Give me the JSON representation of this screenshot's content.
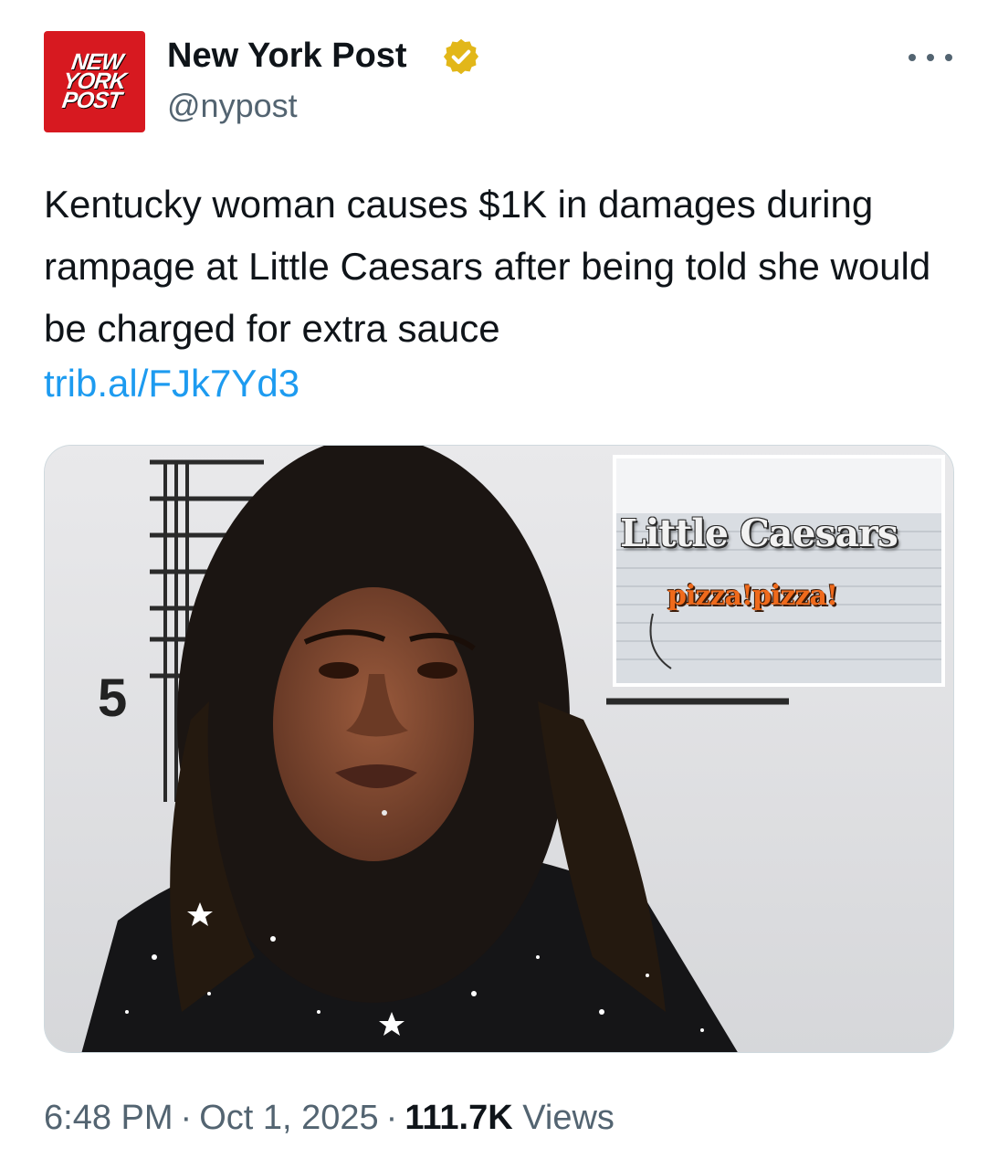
{
  "author": {
    "avatar_text": "NEW\nYORK\nPOST",
    "display_name": "New York Post",
    "handle": "@nypost",
    "verified": true
  },
  "tweet": {
    "text": "Kentucky woman causes $1K in damages during rampage at Little Caesars after being told she would be charged for extra sauce",
    "link": "trib.al/FJk7Yd3"
  },
  "media": {
    "ruler_number": "5",
    "inset_sign_main": "Little Caesars",
    "inset_sign_sub": "pizza!pizza!"
  },
  "meta": {
    "time": "6:48 PM",
    "separator": "·",
    "date": "Oct 1, 2025",
    "views_count": "111.7K",
    "views_label": "Views"
  },
  "colors": {
    "link": "#1d9bf0",
    "secondary_text": "#536471",
    "brand_red": "#d71920",
    "verified_gold": "#e2b719"
  },
  "icons": {
    "verified": "verified-badge-icon",
    "more": "more-options-icon"
  }
}
